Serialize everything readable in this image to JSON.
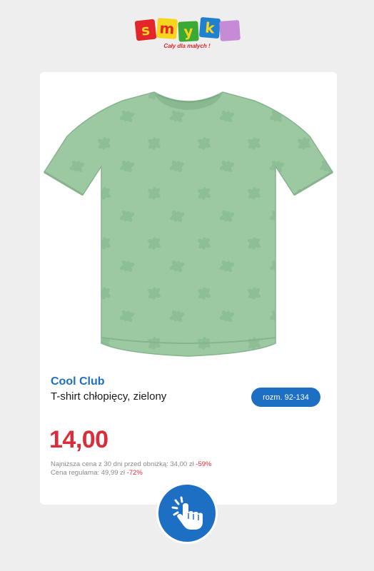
{
  "logo": {
    "letters": [
      "s",
      "m",
      "y",
      "k"
    ],
    "tagline": "Cały dla małych !"
  },
  "product": {
    "image_icon": "green-tshirt-image",
    "brand": "Cool Club",
    "name": "T-shirt chłopięcy, zielony",
    "size_label": "rozm. 92-134",
    "price": "14,00",
    "lowest_price_note": "Najniższa cena z 30 dni przed obniżką: 34,00 zł",
    "lowest_price_discount": "-59%",
    "regular_price_note": "Cena regularna: 49,99 zł",
    "regular_price_discount": "-72%"
  },
  "tap_button": {
    "icon": "tap-hand-icon"
  },
  "colors": {
    "background": "#eeeeee",
    "brand_blue": "#1d6fc4",
    "price_red": "#d92d3a",
    "shirt_green": "#9cc9a2"
  }
}
